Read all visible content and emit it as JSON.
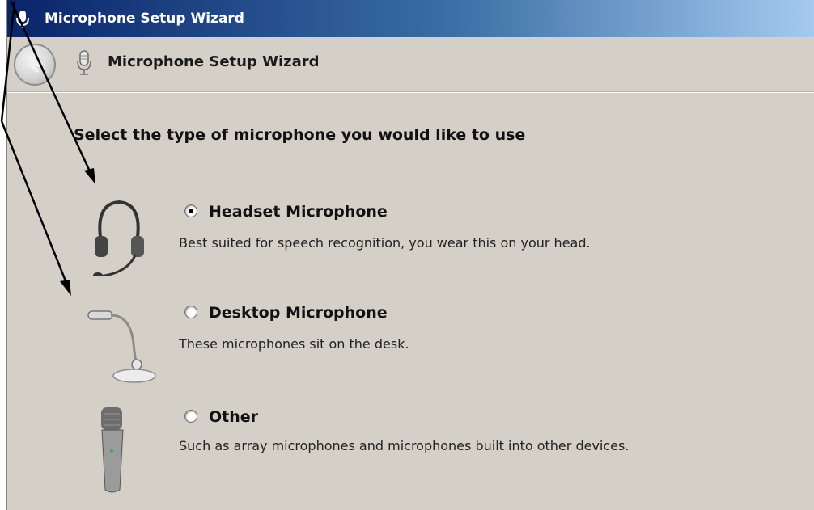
{
  "window": {
    "title": "Microphone Setup Wizard",
    "nav_title": "Microphone Setup Wizard"
  },
  "page": {
    "heading": "Select the type of microphone you would like to use",
    "selected_option": "headset"
  },
  "options": [
    {
      "id": "headset",
      "label": "Headset Microphone",
      "description": "Best suited for speech recognition, you wear this on your head.",
      "selected": true,
      "image": "headset-image"
    },
    {
      "id": "desktop",
      "label": "Desktop Microphone",
      "description": "These microphones sit on the desk.",
      "selected": false,
      "image": "desktop-microphone-image"
    },
    {
      "id": "other",
      "label": "Other",
      "description": "Such as array microphones and microphones built into other devices.",
      "selected": false,
      "image": "handheld-microphone-image"
    }
  ],
  "colors": {
    "titlebar_start": "#0a246a",
    "titlebar_end": "#a6caf0",
    "window_background": "#d4d0c8",
    "annotation_arrows": "#000000"
  },
  "icons": [
    "microphone-icon",
    "back-arrow-icon",
    "headset-image",
    "desktop-microphone-image",
    "handheld-microphone-image"
  ]
}
